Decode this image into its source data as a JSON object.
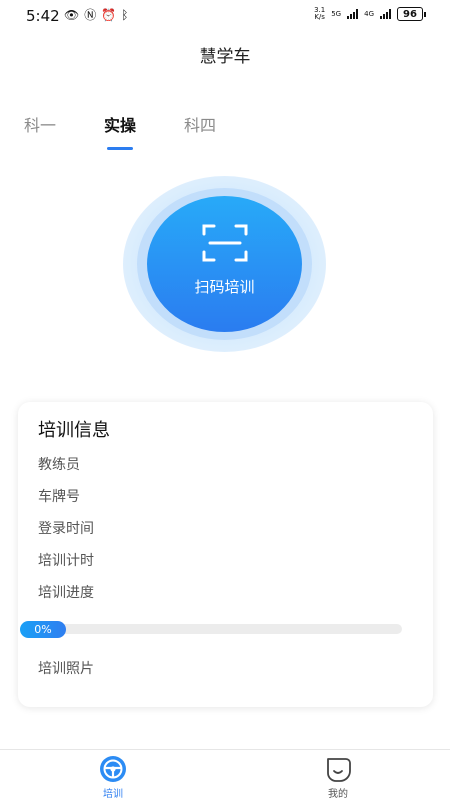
{
  "status_bar": {
    "time": "5:42",
    "net_speed_value": "3.1",
    "net_speed_unit": "K/s",
    "net_5g": "5G",
    "net_4g": "4G",
    "battery": "96"
  },
  "header": {
    "title": "慧学车"
  },
  "tabs": [
    {
      "label": "科一",
      "active": false
    },
    {
      "label": "实操",
      "active": true
    },
    {
      "label": "科四",
      "active": false
    }
  ],
  "scan": {
    "label": "扫码培训"
  },
  "info_card": {
    "title": "培训信息",
    "rows": [
      "教练员",
      "车牌号",
      "登录时间",
      "培训计时",
      "培训进度"
    ],
    "progress": {
      "value": 0,
      "label": "0%"
    },
    "photos_label": "培训照片"
  },
  "bottom_nav": {
    "items": [
      {
        "label": "培训",
        "icon": "steering-wheel-icon",
        "active": true
      },
      {
        "label": "我的",
        "icon": "profile-face-icon",
        "active": false
      }
    ]
  },
  "colors": {
    "accent": "#2c7df0",
    "scan_gradient_top": "#28aaf8",
    "scan_gradient_bottom": "#2a7cf0"
  }
}
